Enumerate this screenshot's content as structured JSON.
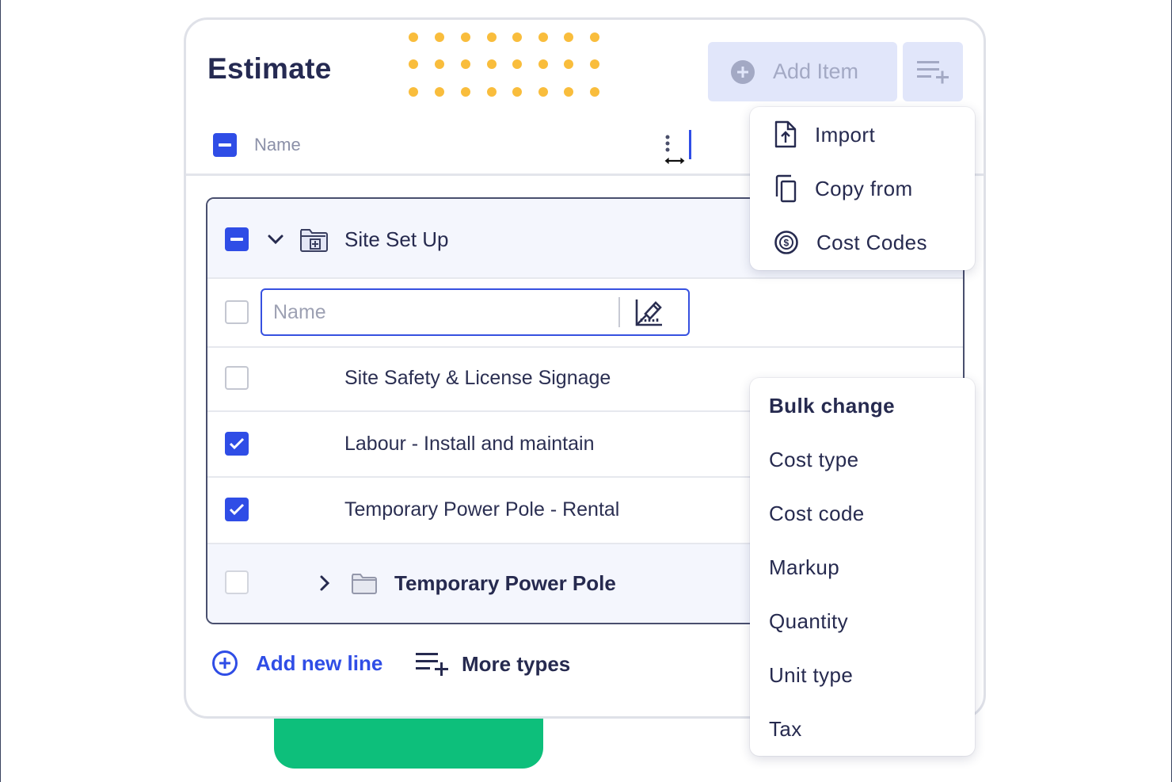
{
  "header": {
    "title": "Estimate",
    "add_item_label": "Add Item"
  },
  "table": {
    "column_name_label": "Name"
  },
  "group": {
    "title": "Site Set Up",
    "name_input_placeholder": "Name",
    "items": [
      {
        "label": "Site Safety & License Signage",
        "checked": false
      },
      {
        "label": "Labour - Install and maintain",
        "checked": true
      },
      {
        "label": "Temporary Power Pole - Rental",
        "checked": true
      }
    ],
    "subgroup_title": "Temporary Power Pole"
  },
  "footer": {
    "add_line_label": "Add new line",
    "more_types_label": "More types"
  },
  "add_menu": {
    "items": [
      {
        "label": "Import",
        "icon": "file-upload-icon"
      },
      {
        "label": "Copy from",
        "icon": "copy-icon"
      },
      {
        "label": "Cost Codes",
        "icon": "dollar-circle-icon"
      }
    ]
  },
  "bulk_menu": {
    "heading": "Bulk change",
    "items": [
      "Cost type",
      "Cost code",
      "Markup",
      "Quantity",
      "Unit type",
      "Tax"
    ]
  },
  "colors": {
    "accent_blue": "#2f4de6",
    "title_navy": "#252a52",
    "dots_yellow": "#f9bd3c",
    "green_shape": "#0dbf7b",
    "button_disabled_bg": "#e1e6fa"
  }
}
